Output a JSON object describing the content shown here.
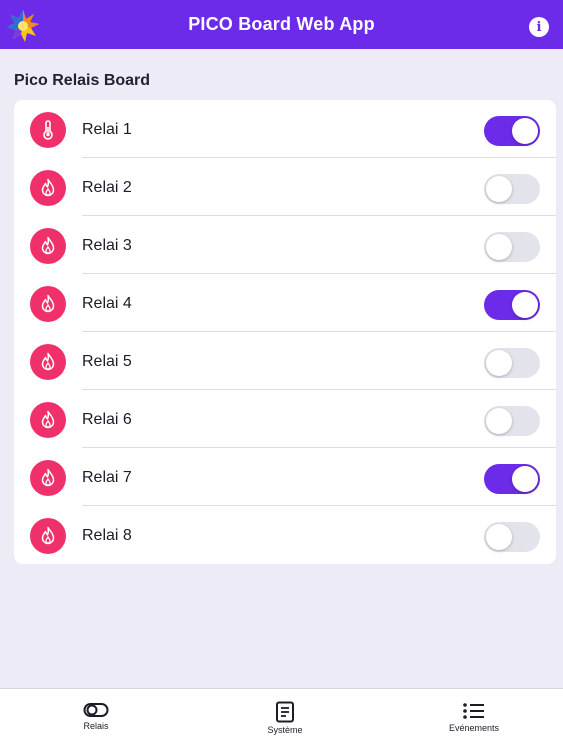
{
  "header": {
    "title": "PICO Board Web App",
    "info_icon": "info-icon",
    "logo_icon": "colorful-sun-logo"
  },
  "section": {
    "title": "Pico Relais Board"
  },
  "relays": [
    {
      "label": "Relai 1",
      "icon": "thermometer-icon",
      "on": true
    },
    {
      "label": "Relai 2",
      "icon": "flame-icon",
      "on": false
    },
    {
      "label": "Relai 3",
      "icon": "flame-icon",
      "on": false
    },
    {
      "label": "Relai 4",
      "icon": "flame-icon",
      "on": true
    },
    {
      "label": "Relai 5",
      "icon": "flame-icon",
      "on": false
    },
    {
      "label": "Relai 6",
      "icon": "flame-icon",
      "on": false
    },
    {
      "label": "Relai 7",
      "icon": "flame-icon",
      "on": true
    },
    {
      "label": "Relai 8",
      "icon": "flame-icon",
      "on": false
    }
  ],
  "tabs": [
    {
      "label": "Relais",
      "icon": "toggle-icon"
    },
    {
      "label": "Système",
      "icon": "document-icon"
    },
    {
      "label": "Evénements",
      "icon": "list-icon"
    }
  ],
  "colors": {
    "accent": "#6b2be8",
    "icon_bg": "#f0306a",
    "background": "#edecf6"
  }
}
